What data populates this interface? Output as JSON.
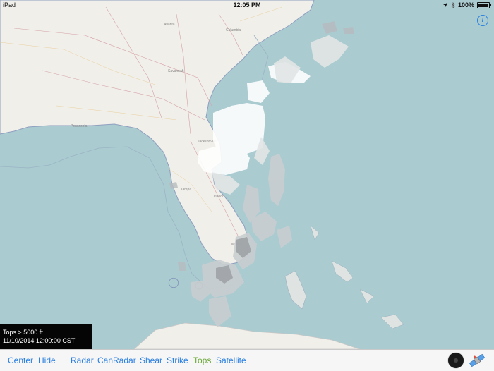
{
  "status_bar": {
    "device": "iPad",
    "time": "12:05 PM",
    "battery": "100%"
  },
  "legend": {
    "line1": "Tops  > 5000 ft",
    "line2": "11/10/2014 12:00:00 CST"
  },
  "toolbar": {
    "buttons": [
      "Center",
      "Hide",
      "Radar",
      "CanRadar",
      "Shear",
      "Strike",
      "Tops",
      "Satellite"
    ],
    "active": "Tops"
  },
  "colors": {
    "water": "#aacbd0",
    "land": "#f1efe9",
    "accent": "#2a7fe0",
    "active": "#6aa838"
  },
  "icons": [
    "location-arrow-icon",
    "bluetooth-icon",
    "battery-icon",
    "info-icon",
    "record-icon",
    "satellite-icon"
  ]
}
